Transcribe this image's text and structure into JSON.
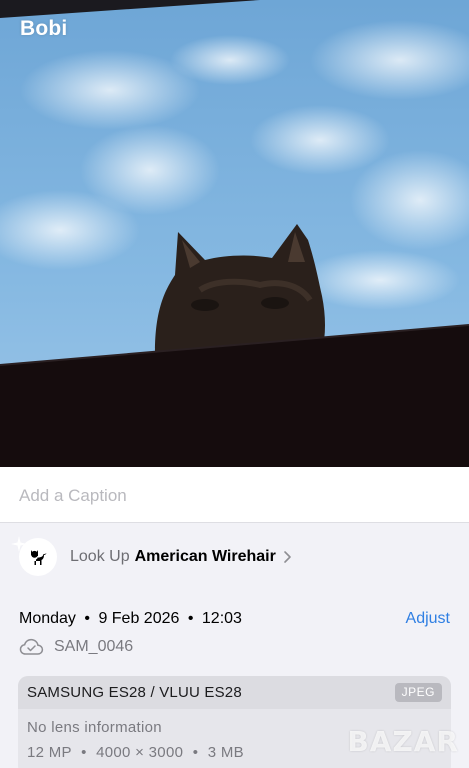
{
  "album": {
    "title": "Bobi"
  },
  "caption": {
    "placeholder": "Add a Caption"
  },
  "lookup": {
    "label": "Look Up",
    "subject": "American Wirehair",
    "icon": "cat-icon"
  },
  "date": {
    "day": "Monday",
    "date": "9 Feb 2026",
    "time": "12:03",
    "separator": "•"
  },
  "adjust_label": "Adjust",
  "file": {
    "name": "SAM_0046",
    "icon": "icloud-check-icon"
  },
  "camera": {
    "model": "SAMSUNG ES28 / VLUU ES28",
    "format": "JPEG",
    "lens": "No lens information",
    "megapixels": "12 MP",
    "resolution": "4000 × 3000",
    "size": "3 MB",
    "separator": "•"
  },
  "watermark": "BAZAR"
}
